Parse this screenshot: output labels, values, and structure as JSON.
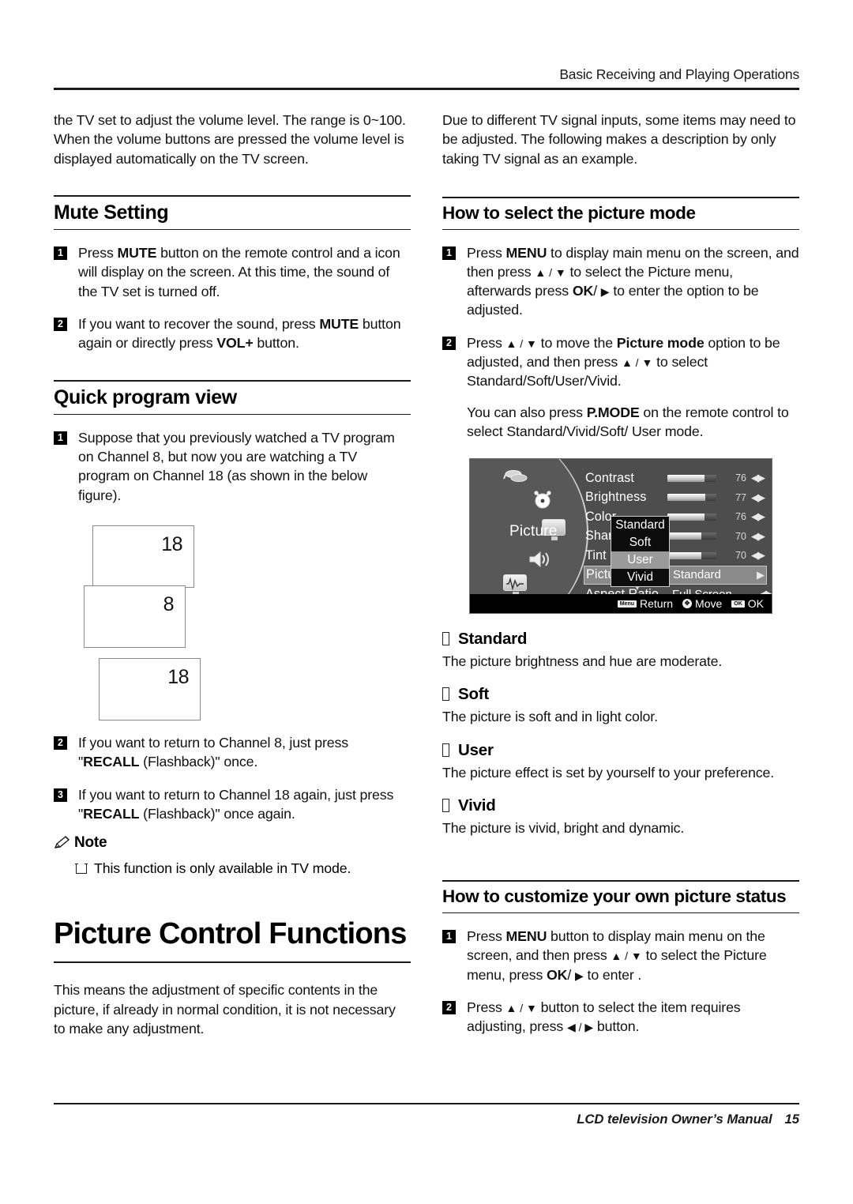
{
  "header": {
    "title": "Basic Receiving and Playing Operations"
  },
  "footer": {
    "manual": "LCD television Owner’s Manual",
    "page_number": "15"
  },
  "left_column": {
    "intro_paragraph": "the TV set to adjust the volume level. The range is 0~100. When the volume buttons are pressed the volume level is displayed automatically on the TV screen.",
    "mute_section": {
      "heading": "Mute Setting",
      "steps": [
        {
          "num": "1",
          "parts": [
            {
              "t": "Press ",
              "b": false
            },
            {
              "t": "MUTE",
              "b": true
            },
            {
              "t": " button on the remote control and a icon will display on the screen. At this time, the sound of the TV set is turned off.",
              "b": false
            }
          ]
        },
        {
          "num": "2",
          "parts": [
            {
              "t": "If you want to recover the sound, press ",
              "b": false
            },
            {
              "t": "MUTE",
              "b": true
            },
            {
              "t": " button again or directly press ",
              "b": false
            },
            {
              "t": "VOL+",
              "b": true
            },
            {
              "t": " button.",
              "b": false
            }
          ]
        }
      ]
    },
    "quick_program_section": {
      "heading": "Quick program view",
      "steps": [
        {
          "num": "1",
          "parts": [
            {
              "t": "Suppose that you previously watched a TV program on Channel 8, but now you are watching a TV program on Channel 18 (as shown in the below figure).",
              "b": false
            }
          ]
        },
        {
          "num": "2",
          "parts": [
            {
              "t": "If you want to return to Channel 8, just press \"",
              "b": false
            },
            {
              "t": "RECALL",
              "b": true
            },
            {
              "t": " (Flashback)\" once.",
              "b": false
            }
          ]
        },
        {
          "num": "3",
          "parts": [
            {
              "t": "If you want to return to Channel 18 again, just press \"",
              "b": false
            },
            {
              "t": "RECALL",
              "b": true
            },
            {
              "t": " (Flashback)\" once again.",
              "b": false
            }
          ]
        }
      ],
      "figure": {
        "boxes": [
          {
            "label": "18"
          },
          {
            "label": "8"
          },
          {
            "label": "18"
          }
        ]
      }
    },
    "note": {
      "label": "Note",
      "items": [
        "This function is only available in TV mode."
      ]
    },
    "picture_control": {
      "heading": "Picture Control Functions",
      "paragraph": "This means the adjustment of specific contents in the picture, if already in normal condition, it is not necessary to make any adjustment."
    }
  },
  "right_column": {
    "intro_paragraph": "Due to different TV signal inputs, some items may need to be adjusted. The following makes a description by only taking TV signal as an example.",
    "picture_mode_section": {
      "heading": "How to select the picture mode",
      "steps": [
        {
          "num": "1",
          "parts": [
            {
              "t": "Press ",
              "b": false
            },
            {
              "t": "MENU",
              "b": true
            },
            {
              "t": " to display main menu on the screen, and then press ",
              "b": false
            },
            {
              "t": "▲ / ▼",
              "b": false,
              "arrow": true
            },
            {
              "t": " to select the Picture menu, afterwards press ",
              "b": false
            },
            {
              "t": "OK",
              "b": true
            },
            {
              "t": "/ ",
              "b": false
            },
            {
              "t": "▶",
              "b": false,
              "arrow": true
            },
            {
              "t": " to enter the option to be adjusted.",
              "b": false
            }
          ]
        },
        {
          "num": "2",
          "parts": [
            {
              "t": "Press ",
              "b": false
            },
            {
              "t": "▲ / ▼",
              "b": false,
              "arrow": true
            },
            {
              "t": " to move the ",
              "b": false
            },
            {
              "t": "Picture mode",
              "b": true
            },
            {
              "t": " option to be adjusted, and then press ",
              "b": false
            },
            {
              "t": "▲ / ▼",
              "b": false,
              "arrow": true
            },
            {
              "t": " to select Standard/Soft/User/Vivid.",
              "b": false
            }
          ]
        }
      ],
      "extra_parts": [
        {
          "t": "You can also press ",
          "b": false
        },
        {
          "t": "P.MODE",
          "b": true
        },
        {
          "t": " on the remote control to select Standard/Vivid/Soft/ User mode.",
          "b": false
        }
      ]
    },
    "osd": {
      "menu_title": "Picture",
      "icons": [
        "antenna-icon",
        "clock-icon",
        "monitor-icon",
        "speaker-icon",
        "waveform-icon"
      ],
      "rows": [
        {
          "label": "Contrast",
          "type": "slider",
          "value": "76",
          "fill_pct": 76
        },
        {
          "label": "Brightness",
          "type": "slider",
          "value": "77",
          "fill_pct": 77
        },
        {
          "label": "Color",
          "type": "slider",
          "value": "76",
          "fill_pct": 76
        },
        {
          "label": "Sharpness",
          "type": "slider",
          "value": "70",
          "fill_pct": 70
        },
        {
          "label": "Tint",
          "type": "slider",
          "value": "70",
          "fill_pct": 70
        },
        {
          "label": "Picture Mode",
          "type": "select",
          "value": "Standard",
          "highlighted": true
        },
        {
          "label": "Aspect Ratio",
          "type": "text",
          "value": "Full Screen"
        }
      ],
      "dropdown": {
        "options": [
          "Standard",
          "Soft",
          "User",
          "Vivid"
        ],
        "selected": "User"
      },
      "hints": [
        {
          "key": "Menu",
          "label": "Return"
        },
        {
          "key": "✥",
          "label": "Move"
        },
        {
          "key": "OK",
          "label": "OK"
        }
      ]
    },
    "modes": [
      {
        "name": "Standard",
        "desc": "The picture brightness and hue are moderate."
      },
      {
        "name": "Soft",
        "desc": "The picture is soft and in light color."
      },
      {
        "name": "User",
        "desc": "The picture effect is set by yourself to your preference."
      },
      {
        "name": "Vivid",
        "desc": "The picture is vivid, bright and dynamic."
      }
    ],
    "customize_section": {
      "heading": "How to customize your own picture status",
      "steps": [
        {
          "num": "1",
          "parts": [
            {
              "t": "Press ",
              "b": false
            },
            {
              "t": "MENU",
              "b": true
            },
            {
              "t": "  button to display main menu on the screen, and then press ",
              "b": false
            },
            {
              "t": "▲ / ▼",
              "b": false,
              "arrow": true
            },
            {
              "t": " to select the Picture menu, press ",
              "b": false
            },
            {
              "t": "OK",
              "b": true
            },
            {
              "t": "/ ",
              "b": false
            },
            {
              "t": "▶",
              "b": false,
              "arrow": true
            },
            {
              "t": " to enter .",
              "b": false
            }
          ]
        },
        {
          "num": "2",
          "parts": [
            {
              "t": "Press ",
              "b": false
            },
            {
              "t": "▲ / ▼",
              "b": false,
              "arrow": true
            },
            {
              "t": " button to select the item requires adjusting, press ",
              "b": false
            },
            {
              "t": "◀ / ▶",
              "b": false,
              "arrow": true
            },
            {
              "t": " button.",
              "b": false
            }
          ]
        }
      ]
    }
  },
  "colors": {
    "rule": "#1a1a1a",
    "osd_bg": "#4d4d4d",
    "osd_arc": "#585858",
    "osd_highlight": "#8a8a8a",
    "box_border": "#8d8785"
  }
}
